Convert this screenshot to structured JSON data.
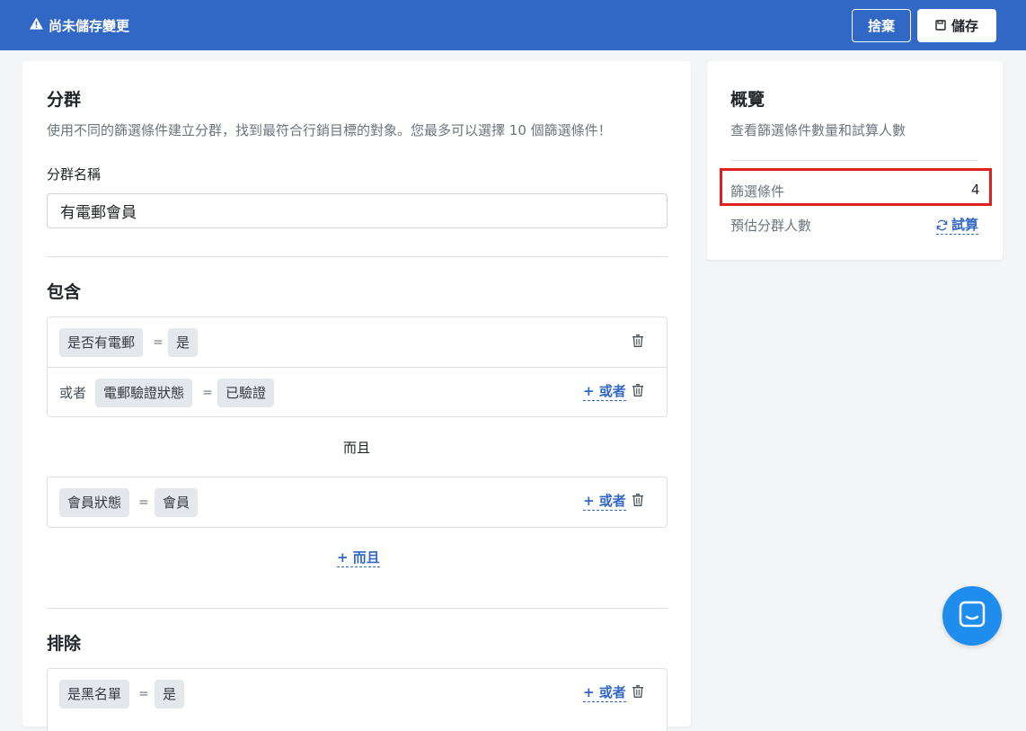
{
  "header": {
    "unsaved_text": "尚未儲存變更",
    "discard_label": "捨棄",
    "save_label": "儲存"
  },
  "segment": {
    "title": "分群",
    "description": "使用不同的篩選條件建立分群，找到最符合行銷目標的對象。您最多可以選擇 10 個篩選條件！",
    "name_label": "分群名稱",
    "name_value": "有電郵會員"
  },
  "include": {
    "title": "包含",
    "groups": [
      {
        "rows": [
          {
            "prefix": "",
            "field": "是否有電郵",
            "operator": "=",
            "value": "是"
          },
          {
            "prefix": "或者",
            "field": "電郵驗證狀態",
            "operator": "=",
            "value": "已驗證",
            "or_label": "+ 或者"
          }
        ]
      },
      {
        "rows": [
          {
            "prefix": "",
            "field": "會員狀態",
            "operator": "=",
            "value": "會員",
            "or_label": "+ 或者"
          }
        ]
      }
    ],
    "and_separator": "而且",
    "add_and_label": "+ 而且"
  },
  "exclude": {
    "title": "排除",
    "rows": [
      {
        "field": "是黑名單",
        "operator": "=",
        "value": "是",
        "or_label": "+ 或者"
      }
    ]
  },
  "overview": {
    "title": "概覽",
    "description": "查看篩選條件數量和試算人數",
    "filter_count_label": "篩選條件",
    "filter_count_value": "4",
    "estimate_label": "預估分群人數",
    "estimate_action": "試算"
  },
  "colors": {
    "primary": "#3167c5",
    "highlight": "#e02020",
    "chat": "#1f8ded"
  },
  "icons": [
    "warning-icon",
    "floppy-disk-icon",
    "trash-icon",
    "refresh-icon",
    "chat-icon"
  ]
}
